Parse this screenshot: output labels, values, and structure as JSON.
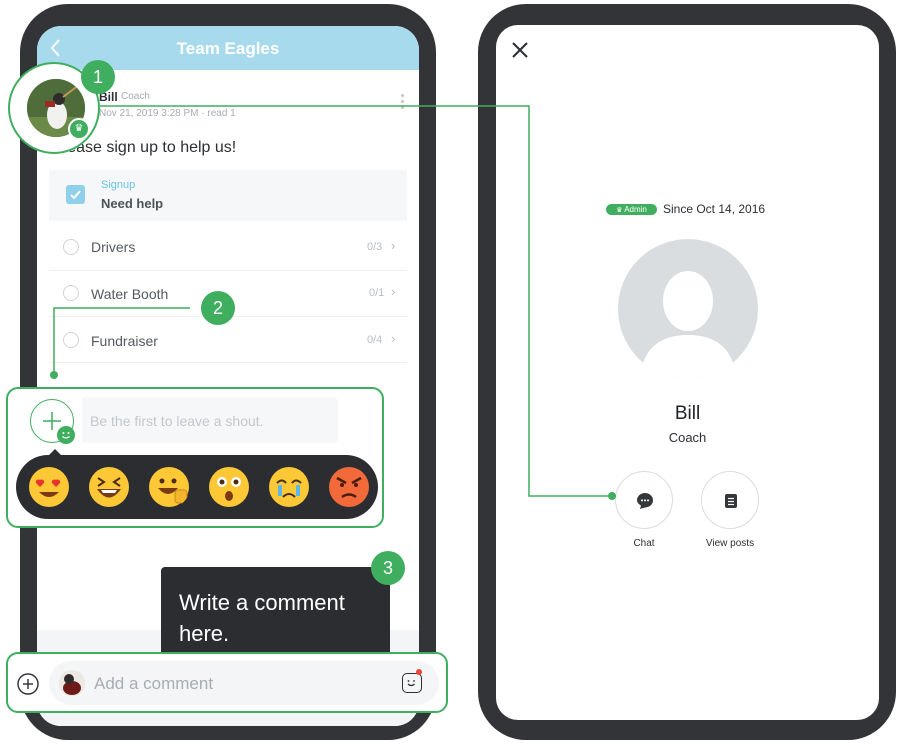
{
  "left_phone": {
    "header_title": "Team Eagles",
    "post": {
      "author": "Bill",
      "role": "Coach",
      "meta": "Nov 21, 2019 3:28 PM · read 1",
      "body": "Please sign up to help us!"
    },
    "signup": {
      "tag": "Signup",
      "title": "Need help",
      "tasks": [
        {
          "label": "Drivers",
          "count": "0/3"
        },
        {
          "label": "Water Booth",
          "count": "0/1"
        },
        {
          "label": "Fundraiser",
          "count": "0/4"
        }
      ]
    },
    "shout_placeholder": "Be the first to leave a shout.",
    "comment_placeholder": "Add a comment"
  },
  "callouts": {
    "badge_1": "1",
    "badge_2": "2",
    "badge_3": "3",
    "tooltip": "Write a comment here."
  },
  "right_phone": {
    "admin_badge": "Admin",
    "since": "Since Oct 14, 2016",
    "name": "Bill",
    "role": "Coach",
    "actions": [
      {
        "label": "Chat",
        "icon": "chat-bubble-icon"
      },
      {
        "label": "View posts",
        "icon": "document-icon"
      }
    ]
  },
  "colors": {
    "header_blue": "#a8daee",
    "accent_green": "#3fae5f",
    "bezel": "#333437",
    "tooltip_bg": "#2b2d31"
  }
}
